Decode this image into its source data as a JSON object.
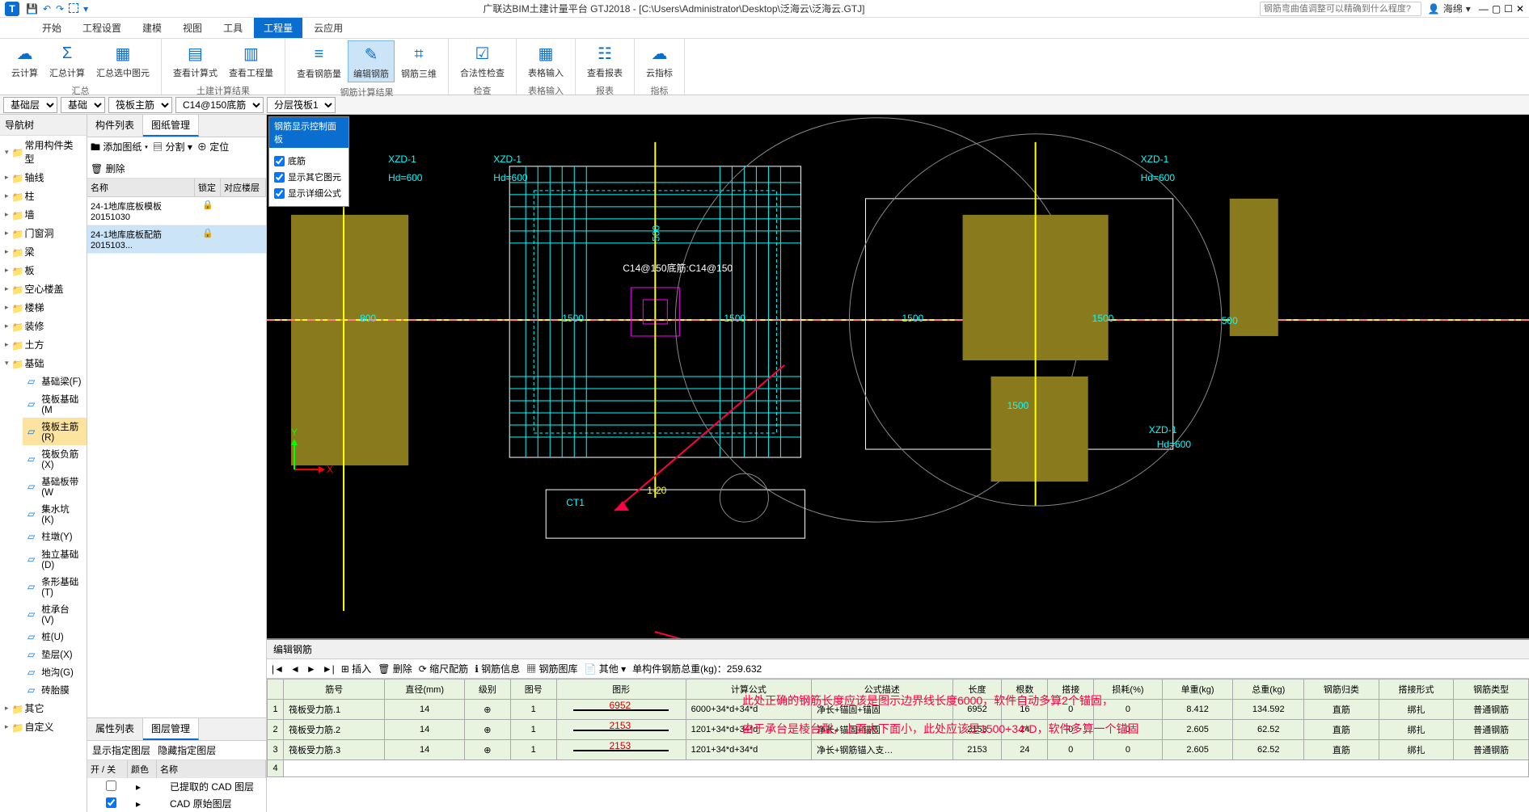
{
  "titlebar": {
    "app_title": "广联达BIM土建计量平台 GTJ2018 - [C:\\Users\\Administrator\\Desktop\\泛海云\\泛海云.GTJ]",
    "search_placeholder": "钢筋弯曲值调整可以精确到什么程度?",
    "user": "海绵"
  },
  "menu": {
    "items": [
      "开始",
      "工程设置",
      "建模",
      "视图",
      "工具",
      "工程量",
      "云应用"
    ],
    "active": 5
  },
  "ribbon": {
    "groups": [
      {
        "label": "汇总",
        "btns": [
          {
            "icon": "☁",
            "txt": "云计算"
          },
          {
            "icon": "Σ",
            "txt": "汇总计算"
          },
          {
            "icon": "▦",
            "txt": "汇总选中图元"
          }
        ]
      },
      {
        "label": "土建计算结果",
        "btns": [
          {
            "icon": "▤",
            "txt": "查看计算式"
          },
          {
            "icon": "▥",
            "txt": "查看工程量"
          }
        ]
      },
      {
        "label": "钢筋计算结果",
        "btns": [
          {
            "icon": "≡",
            "txt": "查看钢筋量"
          },
          {
            "icon": "✎",
            "txt": "编辑钢筋",
            "hl": true
          },
          {
            "icon": "⌗",
            "txt": "钢筋三维"
          }
        ]
      },
      {
        "label": "检查",
        "btns": [
          {
            "icon": "☑",
            "txt": "合法性检查"
          }
        ]
      },
      {
        "label": "表格输入",
        "btns": [
          {
            "icon": "▦",
            "txt": "表格输入"
          }
        ]
      },
      {
        "label": "报表",
        "btns": [
          {
            "icon": "☷",
            "txt": "查看报表"
          }
        ]
      },
      {
        "label": "指标",
        "btns": [
          {
            "icon": "☁",
            "txt": "云指标"
          }
        ]
      }
    ]
  },
  "selectors": {
    "floor": "基础层",
    "cat": "基础",
    "sub": "筏板主筋",
    "spec": "C14@150底筋",
    "span": "分层筏板1"
  },
  "navtree": {
    "title": "导航树",
    "groups": [
      {
        "name": "常用构件类型",
        "exp": true
      },
      {
        "name": "轴线",
        "exp": false
      },
      {
        "name": "柱",
        "exp": false
      },
      {
        "name": "墙",
        "exp": false
      },
      {
        "name": "门窗洞",
        "exp": false
      },
      {
        "name": "梁",
        "exp": false
      },
      {
        "name": "板",
        "exp": false
      },
      {
        "name": "空心楼盖",
        "exp": false
      },
      {
        "name": "楼梯",
        "exp": false
      },
      {
        "name": "装修",
        "exp": false
      },
      {
        "name": "土方",
        "exp": false
      },
      {
        "name": "基础",
        "exp": true,
        "children": [
          "基础梁(F)",
          "筏板基础(M",
          "筏板主筋(R)",
          "筏板负筋(X)",
          "基础板带(W",
          "集水坑(K)",
          "柱墩(Y)",
          "独立基础(D)",
          "条形基础(T)",
          "桩承台(V)",
          "桩(U)",
          "垫层(X)",
          "地沟(G)",
          "砖胎膜"
        ],
        "sel": 2
      },
      {
        "name": "其它",
        "exp": false
      },
      {
        "name": "自定义",
        "exp": false
      }
    ]
  },
  "complist": {
    "tabs": [
      "构件列表",
      "图纸管理"
    ],
    "active": 1,
    "toolbar": [
      "添加图纸",
      "分割",
      "定位",
      "删除"
    ],
    "hdr": [
      "名称",
      "锁定",
      "对应楼层"
    ],
    "rows": [
      {
        "name": "24-1地库底板模板20151030",
        "lock": true
      },
      {
        "name": "24-1地库底板配筋2015103...",
        "lock": true,
        "sel": true
      }
    ]
  },
  "proplist": {
    "tabs": [
      "属性列表",
      "图层管理"
    ],
    "active": 1,
    "btns": [
      "显示指定图层",
      "隐藏指定图层"
    ],
    "hdr": [
      "开 / 关",
      "颜色",
      "名称"
    ],
    "rows": [
      {
        "chk": false,
        "name": "已提取的 CAD 图层"
      },
      {
        "chk": true,
        "name": "CAD 原始图层"
      }
    ]
  },
  "floatpanel": {
    "title": "钢筋显示控制面板",
    "opts": [
      {
        "chk": true,
        "txt": "底筋"
      },
      {
        "chk": true,
        "txt": "显示其它图元"
      },
      {
        "chk": true,
        "txt": "显示详细公式"
      }
    ]
  },
  "cad_labels": {
    "xzd": "XZD-1",
    "hd": "Hd=600",
    "d1500": "1500",
    "d500": "500",
    "d800": "800",
    "ct1": "CT1",
    "rebar_spec": "C14@150底筋:C14@150",
    "axisX": "X",
    "axisY": "Y",
    "jt": "1-20"
  },
  "rebar_panel": {
    "title": "编辑钢筋",
    "tools": [
      "插入",
      "删除",
      "缩尺配筋",
      "钢筋信息",
      "钢筋图库",
      "其他"
    ],
    "total_label": "单构件钢筋总重(kg)：",
    "total": "259.632",
    "hdr": [
      "筋号",
      "直径(mm)",
      "级别",
      "图号",
      "图形",
      "计算公式",
      "公式描述",
      "长度",
      "根数",
      "搭接",
      "损耗(%)",
      "单重(kg)",
      "总重(kg)",
      "钢筋归类",
      "搭接形式",
      "钢筋类型"
    ],
    "rows": [
      {
        "n": "1",
        "name": "筏板受力筋.1",
        "dia": "14",
        "grade": "⊕",
        "pic": "1",
        "shape": "6952",
        "formula": "6000+34*d+34*d",
        "desc": "净长+锚固+锚固",
        "len": "6952",
        "cnt": "16",
        "lap": "0",
        "loss": "0",
        "uw": "8.412",
        "tw": "134.592",
        "cls": "直筋",
        "jt": "绑扎",
        "tp": "普通钢筋"
      },
      {
        "n": "2",
        "name": "筏板受力筋.2",
        "dia": "14",
        "grade": "⊕",
        "pic": "1",
        "shape": "2153",
        "formula": "1201+34*d+34*d",
        "desc": "净长+锚固+锚固",
        "len": "2153",
        "cnt": "24",
        "lap": "0",
        "loss": "0",
        "uw": "2.605",
        "tw": "62.52",
        "cls": "直筋",
        "jt": "绑扎",
        "tp": "普通钢筋"
      },
      {
        "n": "3",
        "name": "筏板受力筋.3",
        "dia": "14",
        "grade": "⊕",
        "pic": "1",
        "shape": "2153",
        "formula": "1201+34*d+34*d",
        "desc": "净长+钢筋锚入支…",
        "len": "2153",
        "cnt": "24",
        "lap": "0",
        "loss": "0",
        "uw": "2.605",
        "tw": "62.52",
        "cls": "直筋",
        "jt": "绑扎",
        "tp": "普通钢筋"
      }
    ]
  },
  "annotations": {
    "a1": "此处正确的钢筋长度应该是图示边界线长度6000，软件自动多算2个锚固，",
    "a2": "由于承台是棱台型，上面大下面小，此处应该是1500+34*D，软件多算一个锚固"
  }
}
